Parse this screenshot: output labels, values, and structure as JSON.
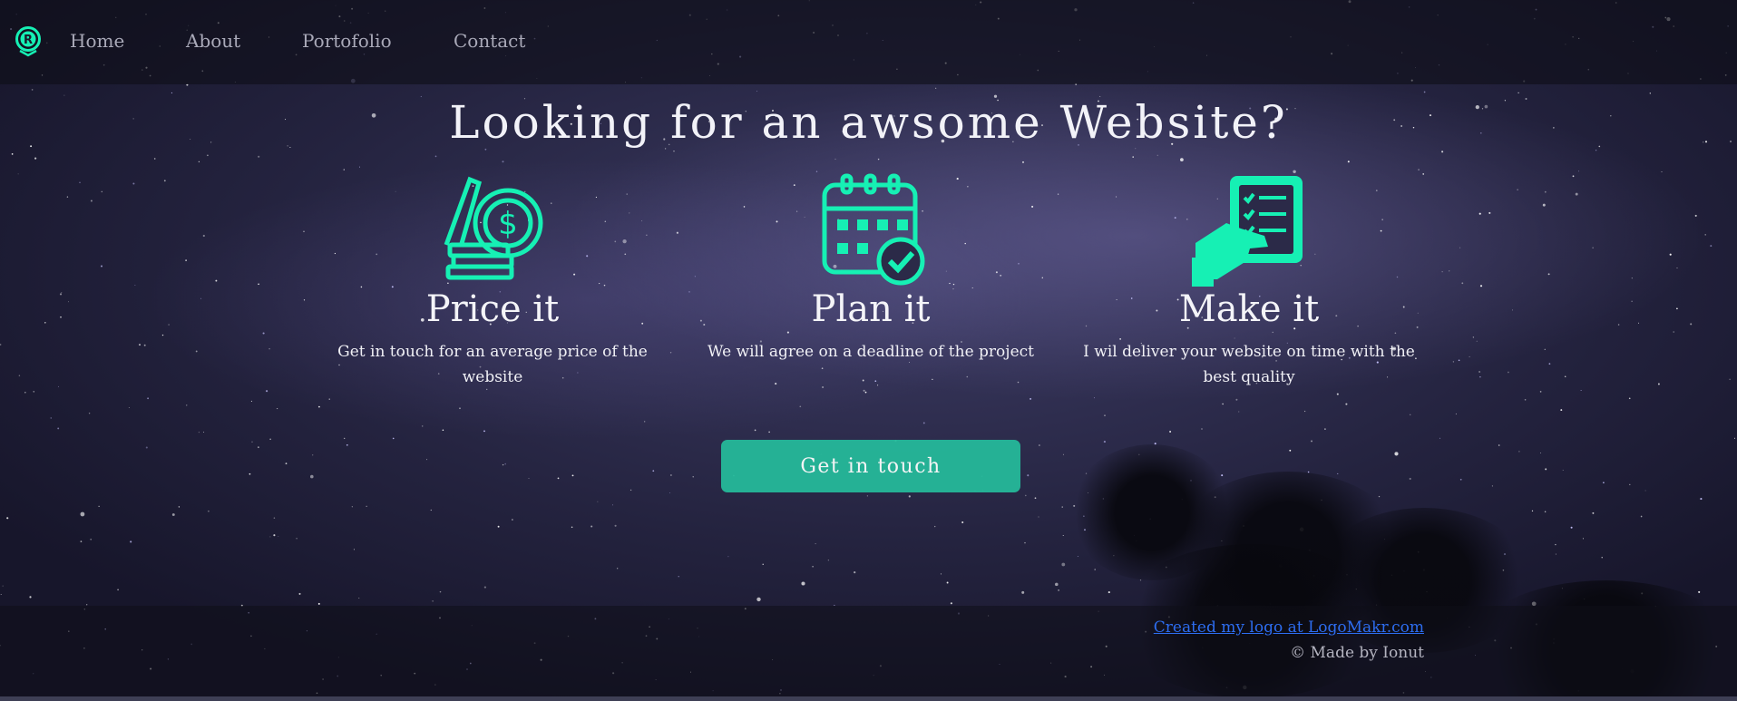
{
  "nav": {
    "logo_icon": "r-badge-logo-icon",
    "links": [
      "Home",
      "About",
      "Portofolio",
      "Contact"
    ]
  },
  "hero": {
    "title": "Looking for an awsome Website?",
    "features": [
      {
        "icon": "coins-dollar-icon",
        "title": "Price it",
        "text": "Get in touch for an average price of the website"
      },
      {
        "icon": "calendar-check-icon",
        "title": "Plan it",
        "text": "We will agree on a deadline of the project"
      },
      {
        "icon": "hand-checklist-icon",
        "title": "Make it",
        "text": "I wil deliver your website on time with the best quality"
      }
    ],
    "cta_label": "Get in touch"
  },
  "footer": {
    "link_text": "Created my logo at LogoMakr.com",
    "copyright": "© Made by Ionut"
  },
  "colors": {
    "accent": "#16f0b4",
    "button": "#25b99a",
    "link": "#2d6df0"
  }
}
